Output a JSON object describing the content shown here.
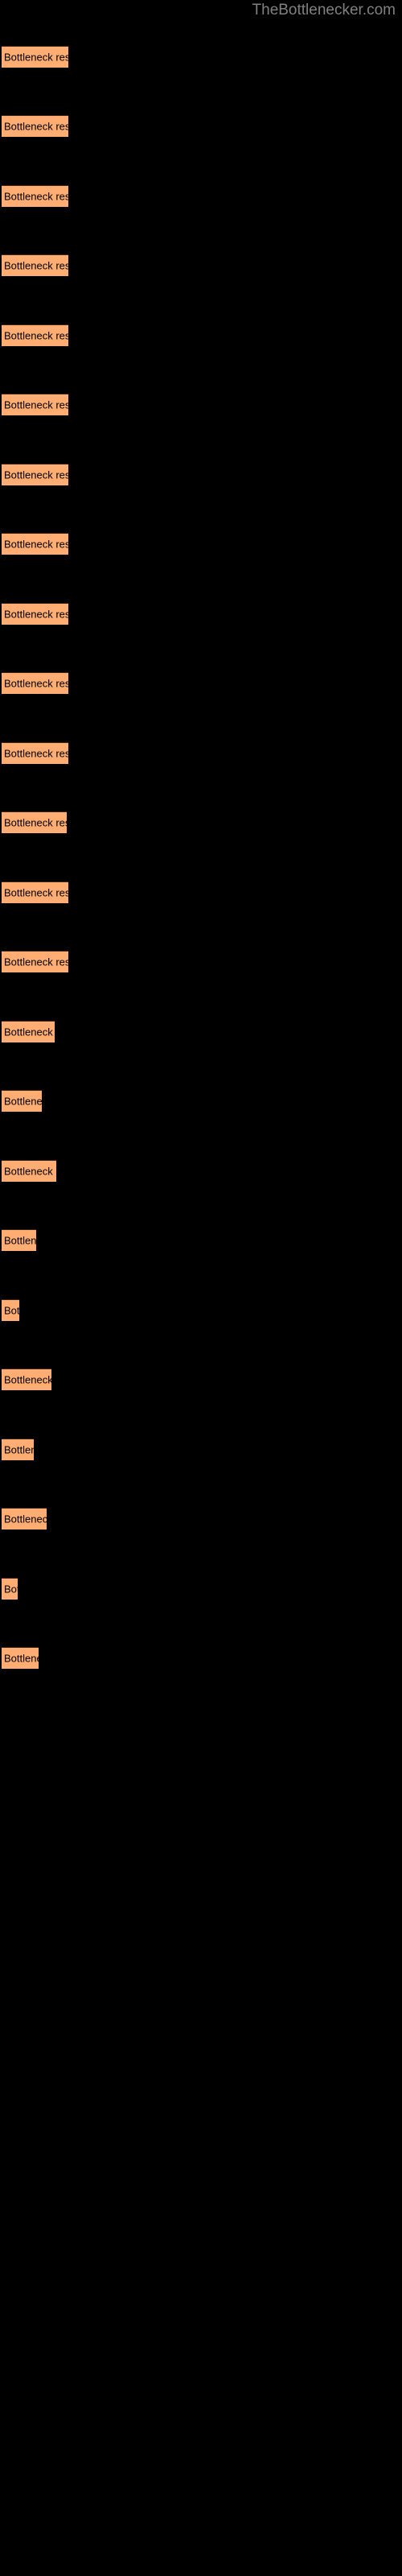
{
  "watermark": {
    "text": "TheBottlenecker.com",
    "color": "#808080"
  },
  "colors": {
    "background": "#000000",
    "bar_fill": "#ffad72",
    "bar_top_border": "#3a2418",
    "label_text": "#000000",
    "watermark_text": "#808080"
  },
  "chart_data": {
    "type": "bar",
    "orientation": "horizontal",
    "title": "",
    "subtitle": "",
    "xlabel": "",
    "ylabel": "",
    "grid": false,
    "legend": null,
    "axis_visible": false,
    "tick_labels": [],
    "xlim": [
      0,
      100
    ],
    "bar_label_text": "Bottleneck result",
    "categories": [
      "Bottleneck result",
      "Bottleneck result",
      "Bottleneck result",
      "Bottleneck result",
      "Bottleneck result",
      "Bottleneck result",
      "Bottleneck result",
      "Bottleneck result",
      "Bottleneck result",
      "Bottleneck result",
      "Bottleneck result",
      "Bottleneck result",
      "Bottleneck result",
      "Bottleneck result",
      "Bottleneck result",
      "Bottleneck result",
      "Bottleneck result",
      "Bottleneck result",
      "Bottleneck result",
      "Bottleneck result",
      "Bottleneck result",
      "Bottleneck result",
      "Bottleneck result",
      "Bottleneck result"
    ],
    "values": [
      83,
      83,
      83,
      83,
      83,
      83,
      83,
      83,
      83,
      83,
      83,
      81,
      83,
      83,
      66,
      50,
      68,
      43,
      22,
      62,
      40,
      56,
      20,
      46
    ],
    "bars": [
      {
        "label": "Bottleneck result",
        "value": 83,
        "y": 57
      },
      {
        "label": "Bottleneck result",
        "value": 83,
        "y": 143
      },
      {
        "label": "Bottleneck result",
        "value": 83,
        "y": 230
      },
      {
        "label": "Bottleneck result",
        "value": 83,
        "y": 316
      },
      {
        "label": "Bottleneck result",
        "value": 83,
        "y": 403
      },
      {
        "label": "Bottleneck result",
        "value": 83,
        "y": 489
      },
      {
        "label": "Bottleneck result",
        "value": 83,
        "y": 576
      },
      {
        "label": "Bottleneck result",
        "value": 83,
        "y": 662
      },
      {
        "label": "Bottleneck result",
        "value": 83,
        "y": 749
      },
      {
        "label": "Bottleneck result",
        "value": 83,
        "y": 835
      },
      {
        "label": "Bottleneck result",
        "value": 83,
        "y": 922
      },
      {
        "label": "Bottleneck result",
        "value": 81,
        "y": 1008
      },
      {
        "label": "Bottleneck result",
        "value": 83,
        "y": 1095
      },
      {
        "label": "Bottleneck result",
        "value": 83,
        "y": 1181
      },
      {
        "label": "Bottleneck result",
        "value": 66,
        "y": 1268
      },
      {
        "label": "Bottleneck result",
        "value": 50,
        "y": 1354
      },
      {
        "label": "Bottleneck result",
        "value": 68,
        "y": 1441
      },
      {
        "label": "Bottleneck result",
        "value": 43,
        "y": 1527
      },
      {
        "label": "Bottleneck result",
        "value": 22,
        "y": 1614
      },
      {
        "label": "Bottleneck result",
        "value": 62,
        "y": 1700
      },
      {
        "label": "Bottleneck result",
        "value": 40,
        "y": 1787
      },
      {
        "label": "Bottleneck result",
        "value": 56,
        "y": 1873
      },
      {
        "label": "Bottleneck result",
        "value": 20,
        "y": 1960
      },
      {
        "label": "Bottleneck result",
        "value": 46,
        "y": 2046
      }
    ]
  }
}
